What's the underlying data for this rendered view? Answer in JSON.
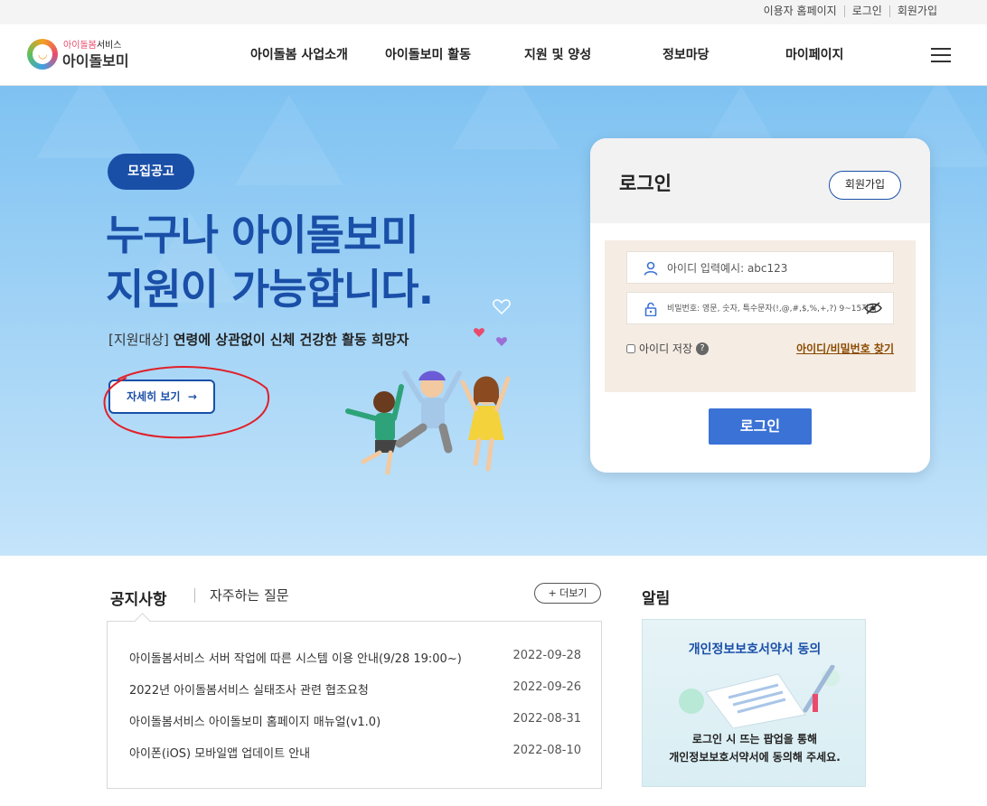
{
  "util_links": [
    "이용자 홈페이지",
    "로그인",
    "회원가입"
  ],
  "logo": {
    "sub_pink": "아이돌봄",
    "sub_rest": "서비스",
    "main": "아이돌보미"
  },
  "nav": [
    "아이돌봄 사업소개",
    "아이돌보미 활동",
    "지원 및 양성",
    "정보마당",
    "마이페이지"
  ],
  "hero": {
    "badge": "모집공고",
    "title_line1": "누구나 아이돌보미",
    "title_line2": "지원이 가능합니다.",
    "desc_label": "[지원대상]",
    "desc_text": "연령에 상관없이 신체 건강한 활동 희망자",
    "detail_button": "자세히 보기",
    "detail_arrow": "→"
  },
  "login": {
    "title": "로그인",
    "join_button": "회원가입",
    "id_placeholder": "아이디 입력예시: abc123",
    "pw_placeholder": "비밀번호: 영문, 숫자, 특수문자(!,@,#,$,%,+,?) 9~15자리",
    "save_id": "아이디 저장",
    "help": "?",
    "find_link": "아이디/비밀번호 찾기",
    "submit": "로그인"
  },
  "notice": {
    "title": "공지사항",
    "tab_faq": "자주하는 질문",
    "more": "+ 더보기",
    "rows": [
      {
        "title": "아이돌봄서비스 서버 작업에 따른 시스템 이용 안내(9/28 19:00~)",
        "date": "2022-09-28"
      },
      {
        "title": "2022년 아이돌봄서비스 실태조사 관련 협조요청",
        "date": "2022-09-26"
      },
      {
        "title": "아이돌봄서비스 아이돌보미 홈페이지 매뉴얼(v1.0)",
        "date": "2022-08-31"
      },
      {
        "title": "아이폰(iOS) 모바일앱 업데이트 안내",
        "date": "2022-08-10"
      }
    ]
  },
  "alert": {
    "title": "알림",
    "box_title": "개인정보보호서약서 동의",
    "box_line1": "로그인 시 뜨는 팝업을 통해",
    "box_line2": "개인정보보호서약서에 동의해 주세요."
  },
  "colors": {
    "brand_blue": "#1a4fa8",
    "login_button": "#3a72d6",
    "hero_bg": "#7ec2f2",
    "annotation_red": "#e0202a"
  }
}
